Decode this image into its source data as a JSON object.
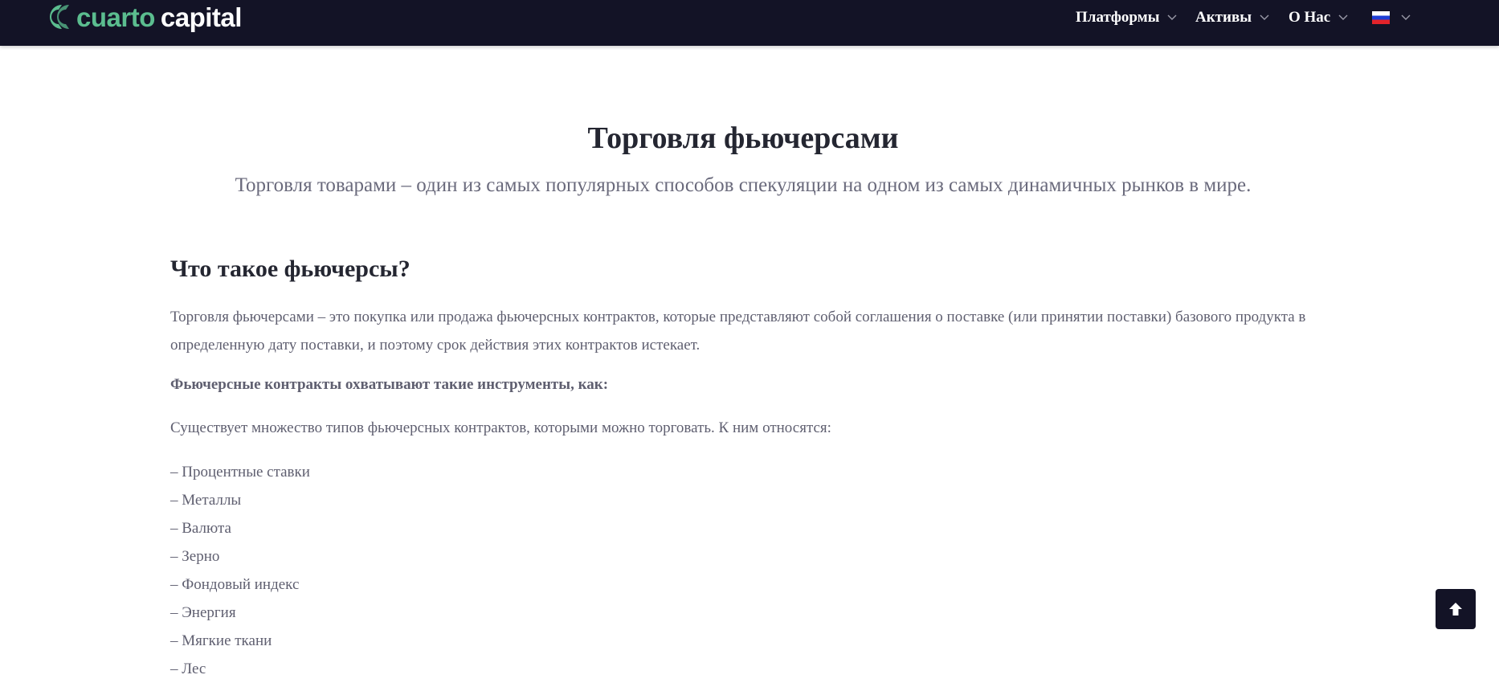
{
  "logo": {
    "word1": "cuarto",
    "word2": "capital"
  },
  "nav": {
    "items": [
      {
        "label": "Платформы"
      },
      {
        "label": "Активы"
      },
      {
        "label": "О Нас"
      }
    ],
    "language_flag": "russia-flag-icon"
  },
  "hero": {
    "title": "Торговля фьючерсами",
    "subtitle": "Торговля товарами – один из самых популярных способов спекуляции на одном из самых динамичных рынков в мире."
  },
  "content": {
    "heading": "Что такое фьючерсы?",
    "paragraph": "Торговля фьючерсами – это покупка или продажа фьючерсных контрактов, которые представляют собой соглашения о поставке (или принятии поставки) базового продукта в определенную дату поставки, и поэтому срок действия этих контрактов истекает.",
    "bold_line": "Фьючерсные контракты охватывают такие инструменты, как:",
    "intro_line": "Существует множество типов фьючерсных контрактов, которыми можно торговать. К ним относятся:",
    "list": [
      "– Процентные ставки",
      "– Металлы",
      "– Валюта",
      "– Зерно",
      "– Фондовый индекс",
      "– Энергия",
      "– Мягкие ткани",
      "– Лес"
    ]
  },
  "colors": {
    "navbar": "#131326",
    "brand_green": "#5bbd8f",
    "heading": "#242631",
    "body_text": "#5f5f70"
  }
}
